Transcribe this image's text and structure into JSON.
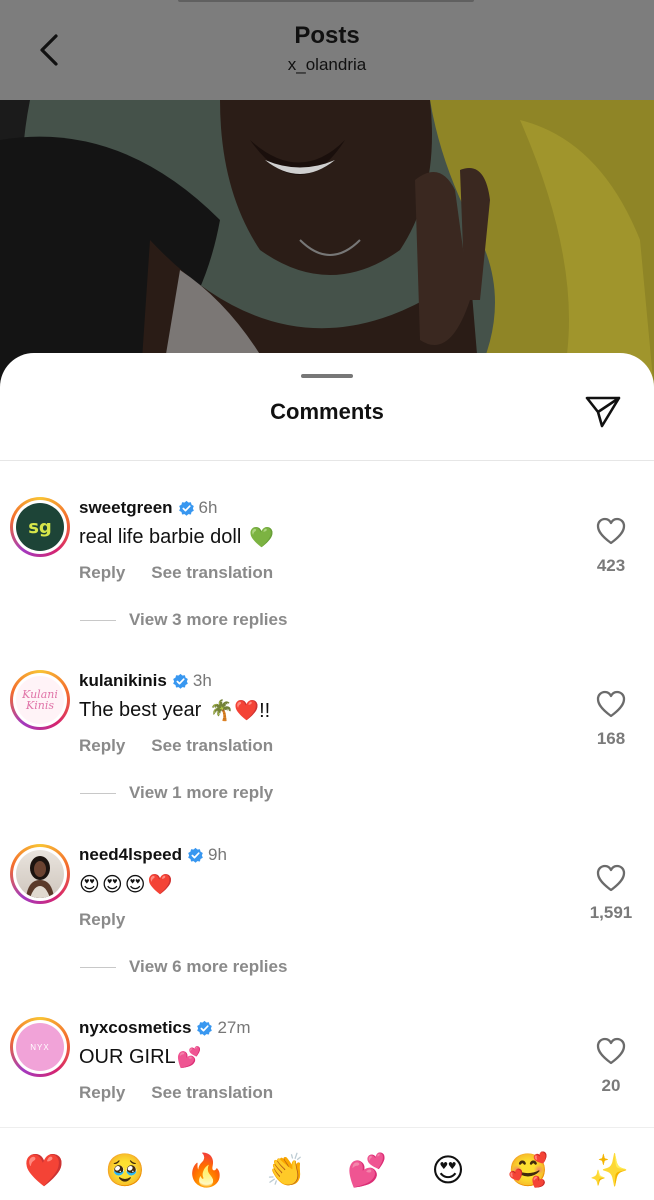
{
  "header": {
    "title": "Posts",
    "username": "x_olandria"
  },
  "sheet": {
    "title": "Comments"
  },
  "comments": [
    {
      "username": "sweetgreen",
      "avatar_text": "sg",
      "time": "6h",
      "text": "real life barbie doll",
      "emojis": "💚",
      "reply_label": "Reply",
      "translation_label": "See translation",
      "view_more": "View 3 more replies",
      "likes": "423"
    },
    {
      "username": "kulanikinis",
      "avatar_text": "Kulani Kinis",
      "time": "3h",
      "text": "The best year",
      "emojis": "🌴❤️!!",
      "reply_label": "Reply",
      "translation_label": "See translation",
      "view_more": "View 1 more reply",
      "likes": "168"
    },
    {
      "username": "need4lspeed",
      "time": "9h",
      "text": "",
      "emojis": "😍😍😍❤️",
      "reply_label": "Reply",
      "view_more": "View 6 more replies",
      "likes": "1,591"
    },
    {
      "username": "nyxcosmetics",
      "avatar_text": "NYX",
      "time": "27m",
      "text": "OUR GIRL",
      "emojis": "💕",
      "reply_label": "Reply",
      "translation_label": "See translation",
      "likes": "20"
    }
  ],
  "quick_emojis": [
    "❤️",
    "🥹",
    "🔥",
    "👏",
    "💕",
    "😍",
    "🥰",
    "✨"
  ],
  "icons": {
    "back": "chevron-left-icon",
    "share": "paper-plane-icon",
    "like": "heart-outline-icon",
    "verified": "verified-badge-icon"
  },
  "colors": {
    "verified": "#3897f0",
    "muted_text": "#8a8a8a",
    "header_dim": "#7d7d7d"
  }
}
